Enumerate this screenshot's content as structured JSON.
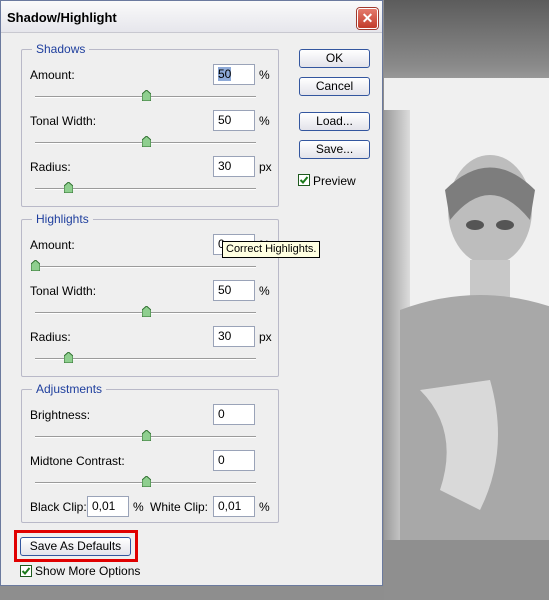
{
  "dialog": {
    "title": "Shadow/Highlight"
  },
  "shadows": {
    "group_label": "Shadows",
    "amount_label": "Amount:",
    "amount_value": "50",
    "amount_unit": "%",
    "amount_level": 0.5,
    "tonal_label": "Tonal Width:",
    "tonal_value": "50",
    "tonal_unit": "%",
    "tonal_level": 0.5,
    "radius_label": "Radius:",
    "radius_value": "30",
    "radius_unit": "px",
    "radius_level": 0.15
  },
  "highlights": {
    "group_label": "Highlights",
    "amount_label": "Amount:",
    "amount_value": "0",
    "amount_unit": "%",
    "amount_level": 0.0,
    "tonal_label": "Tonal Width:",
    "tonal_value": "50",
    "tonal_unit": "%",
    "tonal_level": 0.5,
    "radius_label": "Radius:",
    "radius_value": "30",
    "radius_unit": "px",
    "radius_level": 0.15
  },
  "adjustments": {
    "group_label": "Adjustments",
    "brightness_label": "Brightness:",
    "brightness_value": "0",
    "brightness_level": 0.5,
    "midtone_label": "Midtone Contrast:",
    "midtone_value": "0",
    "midtone_level": 0.5,
    "black_clip_label": "Black Clip:",
    "black_clip_value": "0,01",
    "black_clip_unit": "%",
    "white_clip_label": "White Clip:",
    "white_clip_value": "0,01",
    "white_clip_unit": "%"
  },
  "buttons": {
    "ok": "OK",
    "cancel": "Cancel",
    "load": "Load...",
    "save": "Save...",
    "save_defaults": "Save As Defaults"
  },
  "options": {
    "preview_label": "Preview",
    "preview_checked": true,
    "show_more_label": "Show More Options",
    "show_more_checked": true
  },
  "tooltip": {
    "text": "Correct Highlights."
  },
  "colors": {
    "group_label": "#1f3f9e",
    "button_border": "#33569f",
    "highlight_box": "#e00000",
    "tooltip_bg": "#ffffe1"
  }
}
